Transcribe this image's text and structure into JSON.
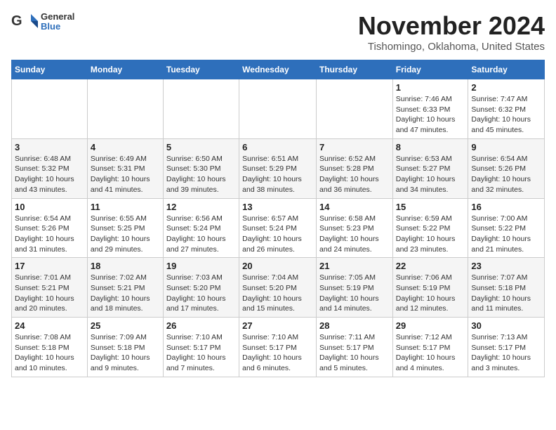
{
  "header": {
    "logo_general": "General",
    "logo_blue": "Blue",
    "month_title": "November 2024",
    "location": "Tishomingo, Oklahoma, United States"
  },
  "weekdays": [
    "Sunday",
    "Monday",
    "Tuesday",
    "Wednesday",
    "Thursday",
    "Friday",
    "Saturday"
  ],
  "weeks": [
    [
      {
        "day": "",
        "info": ""
      },
      {
        "day": "",
        "info": ""
      },
      {
        "day": "",
        "info": ""
      },
      {
        "day": "",
        "info": ""
      },
      {
        "day": "",
        "info": ""
      },
      {
        "day": "1",
        "info": "Sunrise: 7:46 AM\nSunset: 6:33 PM\nDaylight: 10 hours and 47 minutes."
      },
      {
        "day": "2",
        "info": "Sunrise: 7:47 AM\nSunset: 6:32 PM\nDaylight: 10 hours and 45 minutes."
      }
    ],
    [
      {
        "day": "3",
        "info": "Sunrise: 6:48 AM\nSunset: 5:32 PM\nDaylight: 10 hours and 43 minutes."
      },
      {
        "day": "4",
        "info": "Sunrise: 6:49 AM\nSunset: 5:31 PM\nDaylight: 10 hours and 41 minutes."
      },
      {
        "day": "5",
        "info": "Sunrise: 6:50 AM\nSunset: 5:30 PM\nDaylight: 10 hours and 39 minutes."
      },
      {
        "day": "6",
        "info": "Sunrise: 6:51 AM\nSunset: 5:29 PM\nDaylight: 10 hours and 38 minutes."
      },
      {
        "day": "7",
        "info": "Sunrise: 6:52 AM\nSunset: 5:28 PM\nDaylight: 10 hours and 36 minutes."
      },
      {
        "day": "8",
        "info": "Sunrise: 6:53 AM\nSunset: 5:27 PM\nDaylight: 10 hours and 34 minutes."
      },
      {
        "day": "9",
        "info": "Sunrise: 6:54 AM\nSunset: 5:26 PM\nDaylight: 10 hours and 32 minutes."
      }
    ],
    [
      {
        "day": "10",
        "info": "Sunrise: 6:54 AM\nSunset: 5:26 PM\nDaylight: 10 hours and 31 minutes."
      },
      {
        "day": "11",
        "info": "Sunrise: 6:55 AM\nSunset: 5:25 PM\nDaylight: 10 hours and 29 minutes."
      },
      {
        "day": "12",
        "info": "Sunrise: 6:56 AM\nSunset: 5:24 PM\nDaylight: 10 hours and 27 minutes."
      },
      {
        "day": "13",
        "info": "Sunrise: 6:57 AM\nSunset: 5:24 PM\nDaylight: 10 hours and 26 minutes."
      },
      {
        "day": "14",
        "info": "Sunrise: 6:58 AM\nSunset: 5:23 PM\nDaylight: 10 hours and 24 minutes."
      },
      {
        "day": "15",
        "info": "Sunrise: 6:59 AM\nSunset: 5:22 PM\nDaylight: 10 hours and 23 minutes."
      },
      {
        "day": "16",
        "info": "Sunrise: 7:00 AM\nSunset: 5:22 PM\nDaylight: 10 hours and 21 minutes."
      }
    ],
    [
      {
        "day": "17",
        "info": "Sunrise: 7:01 AM\nSunset: 5:21 PM\nDaylight: 10 hours and 20 minutes."
      },
      {
        "day": "18",
        "info": "Sunrise: 7:02 AM\nSunset: 5:21 PM\nDaylight: 10 hours and 18 minutes."
      },
      {
        "day": "19",
        "info": "Sunrise: 7:03 AM\nSunset: 5:20 PM\nDaylight: 10 hours and 17 minutes."
      },
      {
        "day": "20",
        "info": "Sunrise: 7:04 AM\nSunset: 5:20 PM\nDaylight: 10 hours and 15 minutes."
      },
      {
        "day": "21",
        "info": "Sunrise: 7:05 AM\nSunset: 5:19 PM\nDaylight: 10 hours and 14 minutes."
      },
      {
        "day": "22",
        "info": "Sunrise: 7:06 AM\nSunset: 5:19 PM\nDaylight: 10 hours and 12 minutes."
      },
      {
        "day": "23",
        "info": "Sunrise: 7:07 AM\nSunset: 5:18 PM\nDaylight: 10 hours and 11 minutes."
      }
    ],
    [
      {
        "day": "24",
        "info": "Sunrise: 7:08 AM\nSunset: 5:18 PM\nDaylight: 10 hours and 10 minutes."
      },
      {
        "day": "25",
        "info": "Sunrise: 7:09 AM\nSunset: 5:18 PM\nDaylight: 10 hours and 9 minutes."
      },
      {
        "day": "26",
        "info": "Sunrise: 7:10 AM\nSunset: 5:17 PM\nDaylight: 10 hours and 7 minutes."
      },
      {
        "day": "27",
        "info": "Sunrise: 7:10 AM\nSunset: 5:17 PM\nDaylight: 10 hours and 6 minutes."
      },
      {
        "day": "28",
        "info": "Sunrise: 7:11 AM\nSunset: 5:17 PM\nDaylight: 10 hours and 5 minutes."
      },
      {
        "day": "29",
        "info": "Sunrise: 7:12 AM\nSunset: 5:17 PM\nDaylight: 10 hours and 4 minutes."
      },
      {
        "day": "30",
        "info": "Sunrise: 7:13 AM\nSunset: 5:17 PM\nDaylight: 10 hours and 3 minutes."
      }
    ]
  ]
}
